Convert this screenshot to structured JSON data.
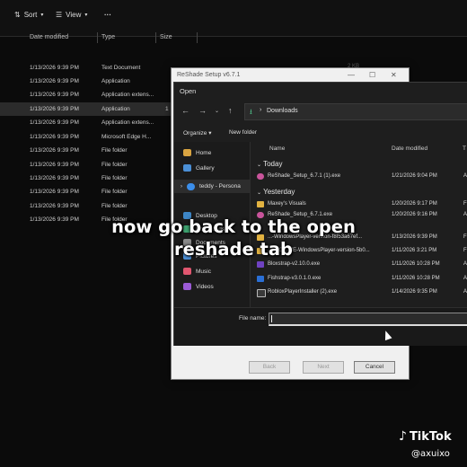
{
  "explorer": {
    "toolbar": {
      "sort": "Sort",
      "view": "View",
      "more": "···"
    },
    "columns": {
      "date_modified": "Date modified",
      "type": "Type",
      "size": "Size"
    },
    "rows": [
      {
        "date": "1/13/2026 9:39 PM",
        "type": "Text Document"
      },
      {
        "date": "1/13/2026 9:39 PM",
        "type": "Application"
      },
      {
        "date": "1/13/2026 9:39 PM",
        "type": "Application extens..."
      },
      {
        "date": "1/13/2026 9:39 PM",
        "type": "Application"
      },
      {
        "date": "1/13/2026 9:39 PM",
        "type": "Application extens..."
      },
      {
        "date": "1/13/2026 9:39 PM",
        "type": "Microsoft Edge H..."
      },
      {
        "date": "1/13/2026 9:39 PM",
        "type": "File folder"
      },
      {
        "date": "1/13/2026 9:39 PM",
        "type": "File folder"
      },
      {
        "date": "1/13/2026 9:39 PM",
        "type": "File folder"
      },
      {
        "date": "1/13/2026 9:39 PM",
        "type": "File folder"
      },
      {
        "date": "1/13/2026 9:39 PM",
        "type": "File folder"
      },
      {
        "date": "1/13/2026 9:39 PM",
        "type": "File folder"
      }
    ],
    "partial_size": "2 KB",
    "partial_size_2": "1"
  },
  "setup": {
    "title": "ReShade Setup v6.7.1",
    "back": "Back",
    "next": "Next",
    "cancel": "Cancel"
  },
  "open_dialog": {
    "title": "Open",
    "address": "Downloads",
    "organize": "Organize",
    "new_folder": "New folder",
    "nav": {
      "home": "Home",
      "gallery": "Gallery",
      "onedrive": "teddy - Persona",
      "desktop": "Desktop",
      "downloads": "Downloads",
      "documents": "Documents",
      "pictures": "Pictures",
      "music": "Music",
      "videos": "Videos"
    },
    "columns": {
      "name": "Name",
      "date": "Date modified",
      "type": "T"
    },
    "groups": {
      "today": "Today",
      "yesterday": "Yesterday"
    },
    "files": [
      {
        "name": "ReShade_Setup_6.7.1 (1).exe",
        "date": "1/21/2026 9:04 PM",
        "type": "A"
      },
      {
        "name": "Maxey's Visuals",
        "date": "1/20/2026 9:17 PM",
        "type": "Fi"
      },
      {
        "name": "ReShade_Setup_6.7.1.exe",
        "date": "1/20/2026 9:16 PM",
        "type": "A"
      },
      {
        "name": "...-WindowsPlayer-version-f8f53a67ef...",
        "date": "1/13/2026 9:39 PM",
        "type": "Fi"
      },
      {
        "name": "...ELO-LIVE-WindowsPlayer-version-5b0...",
        "date": "1/11/2026 3:21 PM",
        "type": "Fi"
      },
      {
        "name": "Bloxstrap-v2.10.0.exe",
        "date": "1/11/2026 10:28 PM",
        "type": "A"
      },
      {
        "name": "Fishstrap-v3.0.1.0.exe",
        "date": "1/11/2026 10:28 PM",
        "type": "A"
      },
      {
        "name": "RobloxPlayerInstaller (2).exe",
        "date": "1/14/2026 9:35 PM",
        "type": "A"
      }
    ],
    "file_name_label": "File name:"
  },
  "caption": {
    "line1": "now go back to the open",
    "line2": "reshade tab"
  },
  "watermark": {
    "brand": "TikTok",
    "user": "@axuixo"
  }
}
